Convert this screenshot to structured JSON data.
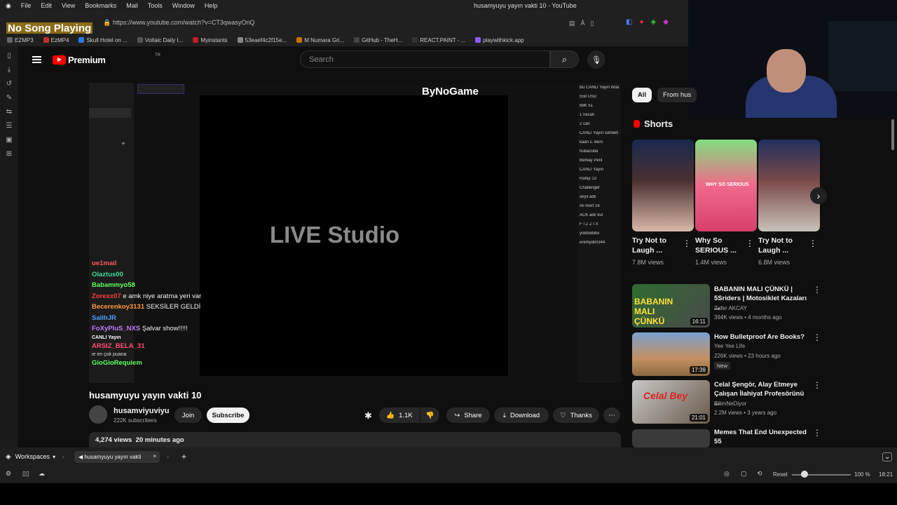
{
  "menubar": {
    "items": [
      "File",
      "Edit",
      "View",
      "Bookmarks",
      "Mail",
      "Tools",
      "Window",
      "Help"
    ],
    "window_title": "husamyuyu yayın vakti 10 - YouTube"
  },
  "address": {
    "url": "https://www.youtube.com/watch?v=CT3qwasyOnQ"
  },
  "overlay": {
    "no_song": "No Song Playing"
  },
  "bookmarks": [
    {
      "label": "EZMP3",
      "color": "#666"
    },
    {
      "label": "EzMP4",
      "color": "#c4302b"
    },
    {
      "label": "Skull Hotel on ...",
      "color": "#2a7de1"
    },
    {
      "label": "Voltaic Daily I...",
      "color": "#555"
    },
    {
      "label": "Myinstants",
      "color": "#c02020"
    },
    {
      "label": "53eaef4c2f15e...",
      "color": "#888"
    },
    {
      "label": "M Numara Gri...",
      "color": "#d07000"
    },
    {
      "label": "GitHub - TheH...",
      "color": "#444"
    },
    {
      "label": "REACT.PAINT - ...",
      "color": "#333"
    },
    {
      "label": "playwithkick.app",
      "color": "#8b5cf6"
    }
  ],
  "youtube": {
    "logo_text": "Premium",
    "logo_sup": "TR",
    "search_placeholder": "Search"
  },
  "player": {
    "center_text": "LIVE Studio",
    "brand": "ByNoGame",
    "right_panel": [
      "Bu CANLI Yayın dolan",
      "558  USD",
      "68K  51",
      "1  necati",
      "2  can",
      "CANLI Yayın sohbeti",
      "kaan s. Beni",
      "hubazuba",
      "Berkay Peril",
      "CANLI Yayın",
      "Rahip 13",
      "Challenger",
      "seyit adlı",
      "Ali mert 16",
      "ACK adlı kul",
      "F İ Z Z İ X",
      "yokboibibii",
      "eremydim344"
    ]
  },
  "chat": [
    {
      "user": "ue1mail",
      "msg": "",
      "color": "#ff5a5a"
    },
    {
      "user": "Olaztus00",
      "msg": "",
      "color": "#3ddc97"
    },
    {
      "user": "Babammyo58",
      "msg": "",
      "color": "#5cff5c"
    },
    {
      "user": "Zorexx07",
      "msg": "e amk niye aratma yeri var",
      "color": "#ff3b3b"
    },
    {
      "user": "Becerenkoy3131",
      "msg": "SEKSİLER GELDİ",
      "color": "#ff9a3c"
    },
    {
      "user": "SalihJR",
      "msg": "",
      "color": "#4a9dff"
    },
    {
      "user": "FoXyPluS_NXS",
      "msg": "Şalvar show!!!!!",
      "color": "#c07bff"
    },
    {
      "user": "CANLI Yayın",
      "msg": "",
      "color": "#ffffff"
    },
    {
      "user": "ARSIZ_BELA_31",
      "msg": "",
      "color": "#ff4d6d"
    },
    {
      "user": "ie en çok puana",
      "msg": "",
      "color": "#dddddd"
    },
    {
      "user": "GioGioRequiem",
      "msg": "",
      "color": "#5cff5c"
    }
  ],
  "video": {
    "title": "husamyuyu yayın vakti 10",
    "channel": "husamviyuviyu",
    "subscribers": "222K subscribers",
    "join": "Join",
    "subscribe": "Subscribe",
    "likes": "1.1K",
    "share": "Share",
    "download": "Download",
    "thanks": "Thanks",
    "views": "4,274 views",
    "time": "20 minutes ago"
  },
  "chips": [
    "All",
    "From hus"
  ],
  "shorts": {
    "header": "Shorts",
    "items": [
      {
        "title": "Try Not to Laugh ...",
        "views": "7.8M views"
      },
      {
        "title": "Why So SERIOUS ...",
        "views": "1.4M views",
        "overlay": "WHY SO SERIOUS"
      },
      {
        "title": "Try Not to Laugh ...",
        "views": "6.8M views"
      }
    ]
  },
  "recommended": [
    {
      "title": "BABANIN MALI ÇÜNKÜ | 5Sriders | Motosiklet Kazaları ...",
      "channel": "Zafer AKCAY",
      "meta": "394K views • 4 months ago",
      "duration": "16:11",
      "thumb_text": "BABANIN MALI ÇÜNKÜ"
    },
    {
      "title": "How Bulletproof Are Books?",
      "channel": "Yee Yee Life",
      "meta": "226K views • 23 hours ago",
      "duration": "17:39",
      "badge": "New"
    },
    {
      "title": "Celal Şengör, Alay Etmeye Çalışan İlahiyat Profesörünü ...",
      "channel": "BilimNeDiyor",
      "meta": "2.2M views • 3 years ago",
      "duration": "21:01",
      "thumb_text": "Celal Bey"
    },
    {
      "title": "Memes That End Unexpected 55",
      "channel": "",
      "meta": "",
      "duration": ""
    }
  ],
  "bottom": {
    "workspaces": "Workspaces",
    "tab_title": "husamyuyu yayın vakti",
    "reset": "Reset",
    "zoom": "100 %",
    "clock": "18:21"
  }
}
